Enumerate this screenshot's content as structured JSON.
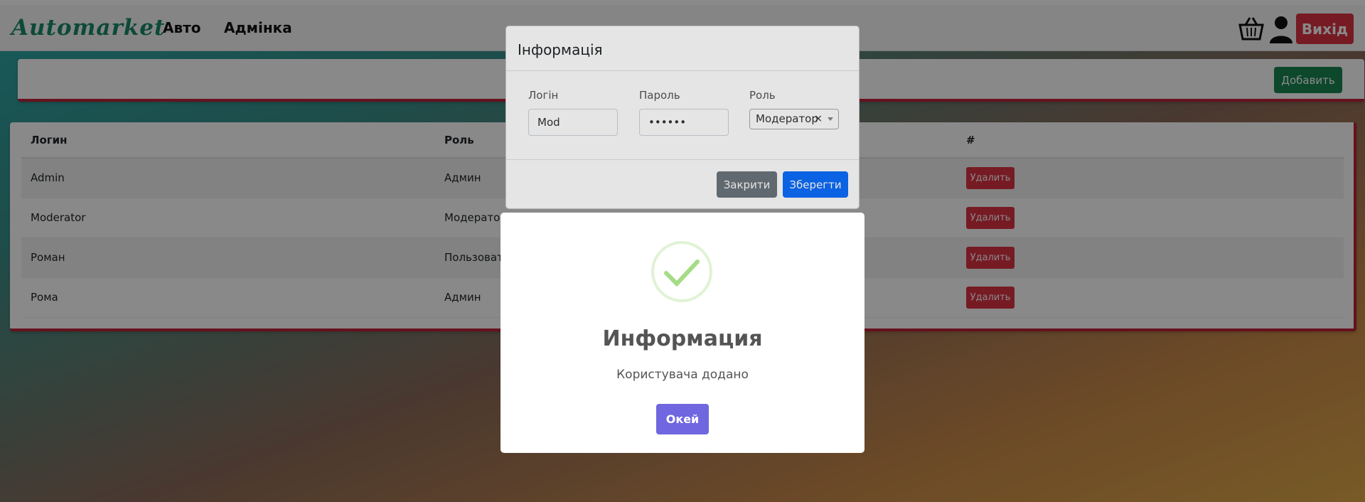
{
  "navbar": {
    "brand": "Automarket",
    "links": [
      "Авто",
      "Адмінка"
    ],
    "logout_label": "Вихід"
  },
  "toolbar": {
    "add_label": "Добавить"
  },
  "table": {
    "headers": [
      "Логин",
      "Роль",
      "#"
    ],
    "rows": [
      {
        "login": "Admin",
        "role": "Админ",
        "action": "Удалить"
      },
      {
        "login": "Moderator",
        "role": "Модератор",
        "action": "Удалить"
      },
      {
        "login": "Роман",
        "role": "Пользователь",
        "action": "Удалить"
      },
      {
        "login": "Рома",
        "role": "Админ",
        "action": "Удалить"
      }
    ]
  },
  "edit_modal": {
    "title": "Інформація",
    "login_label": "Логін",
    "login_value": "Mod",
    "password_label": "Пароль",
    "password_value": "••••••",
    "role_label": "Роль",
    "role_value": "Модератор",
    "role_clear": "×",
    "close_label": "Закрити",
    "save_label": "Зберегти"
  },
  "alert": {
    "title": "Информация",
    "text": "Користувача додано",
    "ok_label": "Окей",
    "success_color": "#a5dc86"
  }
}
